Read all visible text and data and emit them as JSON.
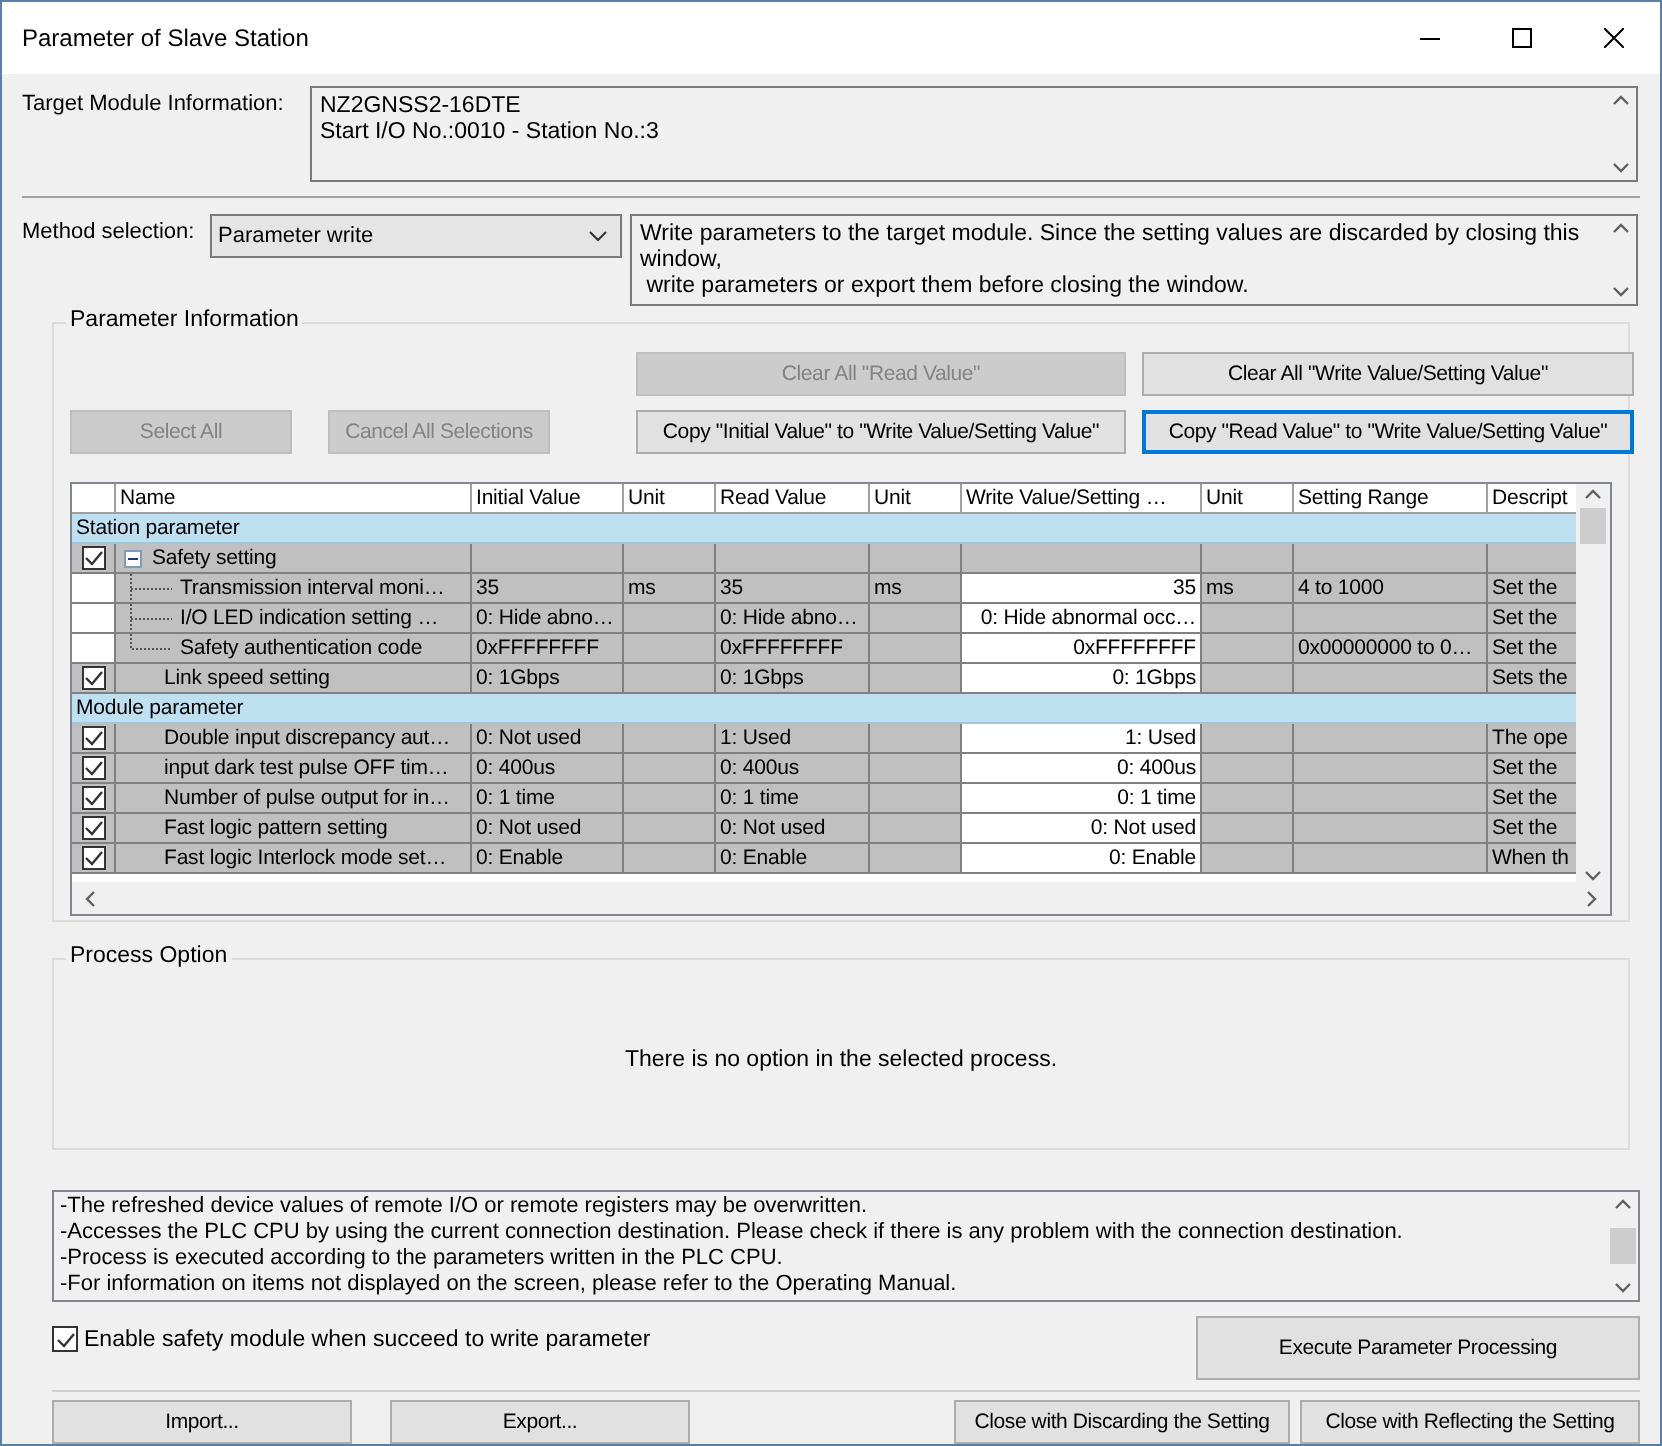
{
  "window": {
    "title": "Parameter of Slave Station"
  },
  "target": {
    "label": "Target Module Information:",
    "lines": [
      "NZ2GNSS2-16DTE",
      "Start I/O No.:0010 - Station No.:3"
    ]
  },
  "method": {
    "label": "Method selection:",
    "value": "Parameter write",
    "description": "Write parameters to the target module. Since the setting values are discarded by closing this window,\n write parameters or export them before closing the window."
  },
  "parameter_information": {
    "title": "Parameter Information",
    "buttons": [
      {
        "label": "Clear All \"Read Value\"",
        "disabled": true,
        "focused": false
      },
      {
        "label": "Clear All \"Write Value/Setting Value\"",
        "disabled": false,
        "focused": false
      },
      {
        "label": "Select All",
        "disabled": true,
        "focused": false
      },
      {
        "label": "Cancel All Selections",
        "disabled": true,
        "focused": false
      },
      {
        "label": "Copy \"Initial Value\" to \"Write Value/Setting Value\"",
        "disabled": false,
        "focused": false
      },
      {
        "label": "Copy \"Read Value\" to \"Write Value/Setting Value\"",
        "disabled": false,
        "focused": true
      }
    ],
    "table": {
      "columns": [
        "Name",
        "Initial Value",
        "Unit",
        "Read Value",
        "Unit",
        "Write Value/Setting …",
        "Unit",
        "Setting Range",
        "Descript"
      ],
      "sections": [
        {
          "title": "Station parameter",
          "items": [
            {
              "name": "Safety setting",
              "checked": true,
              "expanded": true,
              "children": [
                {
                  "name": "Transmission interval moni…",
                  "initial": "35",
                  "unit": "ms",
                  "read": "35",
                  "read_unit": "ms",
                  "write": "35",
                  "write_unit": "ms",
                  "range": "4 to 1000",
                  "description": "Set the"
                },
                {
                  "name": "I/O LED indication setting …",
                  "initial": "0: Hide abno…",
                  "read": "0: Hide abno…",
                  "write": "0: Hide abnormal occ…",
                  "description": "Set the"
                },
                {
                  "name": "Safety authentication code",
                  "initial": "0xFFFFFFFF",
                  "read": "0xFFFFFFFF",
                  "write": "0xFFFFFFFF",
                  "range": "0x00000000 to 0…",
                  "description": "Set the"
                }
              ]
            },
            {
              "name": "Link speed setting",
              "checked": true,
              "initial": "0: 1Gbps",
              "read": "0: 1Gbps",
              "write": "0: 1Gbps",
              "description": "Sets the"
            }
          ]
        },
        {
          "title": "Module parameter",
          "items": [
            {
              "name": "Double input discrepancy aut…",
              "checked": true,
              "initial": "0: Not used",
              "read": "1: Used",
              "write": "1: Used",
              "description": "The ope"
            },
            {
              "name": "input dark test pulse OFF tim…",
              "checked": true,
              "initial": "0: 400us",
              "read": "0: 400us",
              "write": "0: 400us",
              "description": "Set the"
            },
            {
              "name": "Number of pulse output for in…",
              "checked": true,
              "initial": "0: 1 time",
              "read": "0: 1 time",
              "write": "0: 1 time",
              "description": "Set the"
            },
            {
              "name": "Fast logic pattern setting",
              "checked": true,
              "initial": "0: Not used",
              "read": "0: Not used",
              "write": "0: Not used",
              "description": "Set the"
            },
            {
              "name": "Fast logic Interlock mode set…",
              "checked": true,
              "initial": "0: Enable",
              "read": "0: Enable",
              "write": "0: Enable",
              "description": "When th"
            }
          ]
        }
      ]
    }
  },
  "process_option": {
    "title": "Process Option",
    "message": "There is no option in the selected process."
  },
  "notes": [
    "-The refreshed device values of remote I/O or remote registers may be overwritten.",
    "-Accesses the PLC CPU by using the current connection destination. Please check if there is any problem with the connection destination.",
    "-Process is executed according to the parameters written in the PLC CPU.",
    "-For information on items not displayed on the screen, please refer to the Operating Manual."
  ],
  "enable_safety": {
    "label": "Enable safety module when succeed to write parameter",
    "checked": true
  },
  "execute_button": "Execute Parameter Processing",
  "bottom_buttons": [
    "Import...",
    "Export...",
    "Close with Discarding the Setting",
    "Close with Reflecting the Setting"
  ]
}
